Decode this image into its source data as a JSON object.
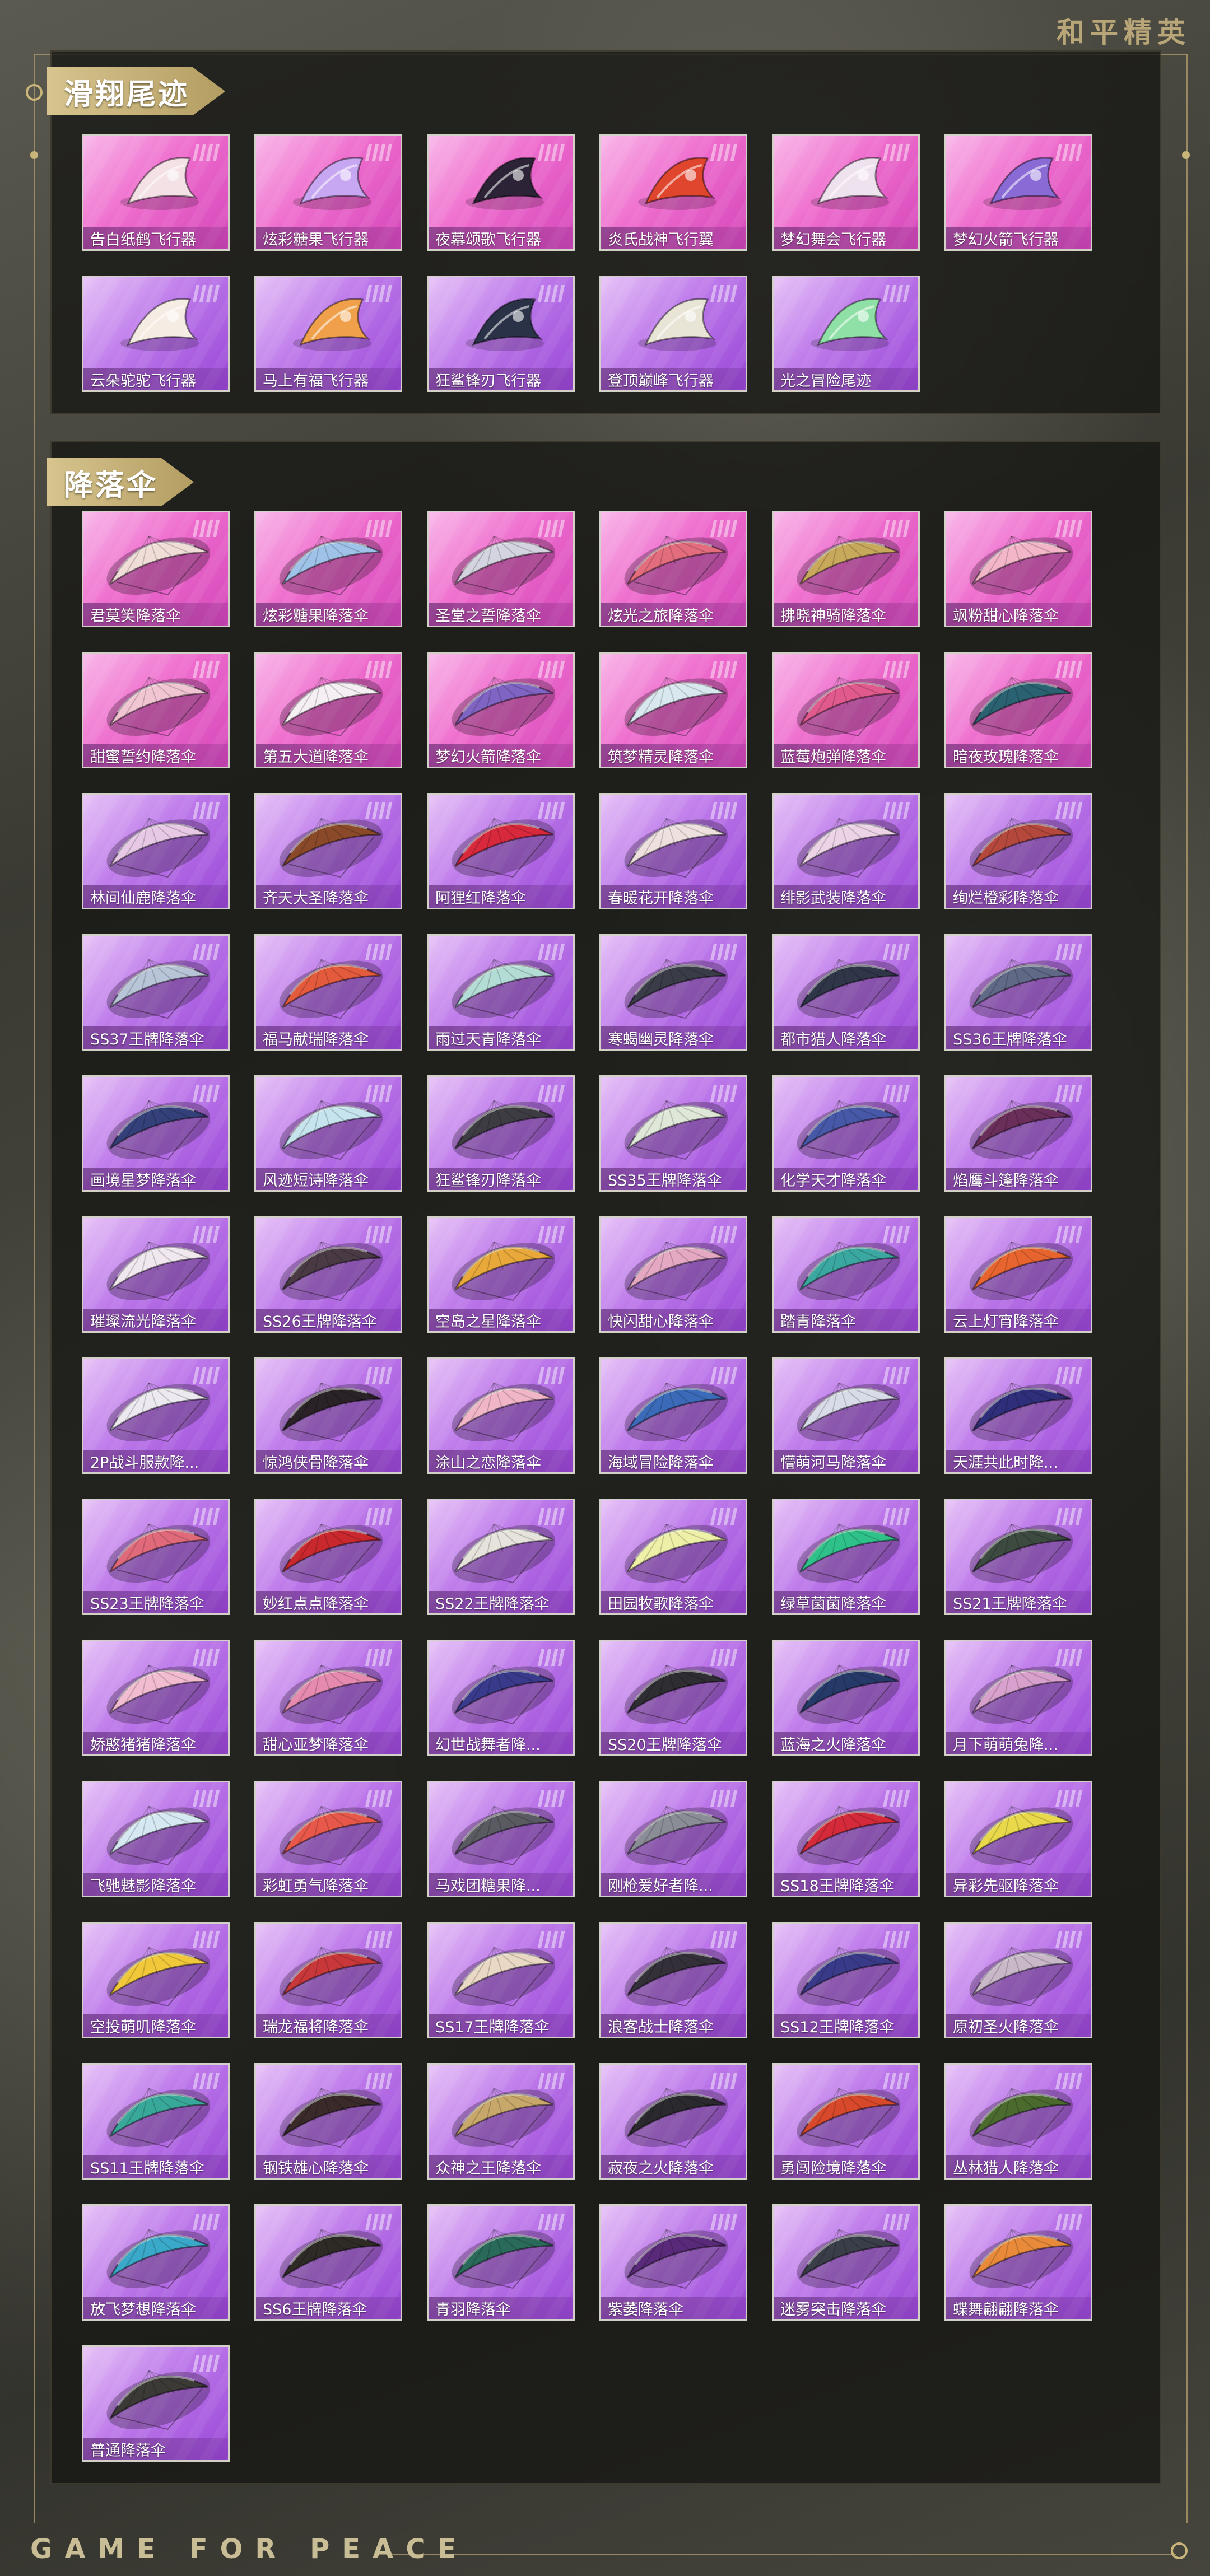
{
  "brand": {
    "top_title": "和平精英",
    "bottom_slogan": "GAME FOR PEACE"
  },
  "colors": {
    "rarity_pink": "#ee6ccd",
    "rarity_purple": "#bd79ea",
    "tag_gold": "#c9b57a"
  },
  "sections": [
    {
      "title": "滑翔尾迹",
      "items": [
        {
          "name": "告白纸鹤飞行器",
          "rarity": "pink",
          "icon": "paper-crane-glider-icon",
          "color": "#f3e1e6"
        },
        {
          "name": "炫彩糖果飞行器",
          "rarity": "pink",
          "icon": "candy-glider-icon",
          "color": "#c8a7f2"
        },
        {
          "name": "夜幕颂歌飞行器",
          "rarity": "pink",
          "icon": "spear-glider-icon",
          "color": "#2c2436"
        },
        {
          "name": "炎氏战神飞行翼",
          "rarity": "pink",
          "icon": "flame-wing-glider-icon",
          "color": "#e0462e"
        },
        {
          "name": "梦幻舞会飞行器",
          "rarity": "pink",
          "icon": "ghost-glider-icon",
          "color": "#efe2ef"
        },
        {
          "name": "梦幻火箭飞行器",
          "rarity": "pink",
          "icon": "rocket-glider-icon",
          "color": "#8a6bd6"
        },
        {
          "name": "云朵驼驼飞行器",
          "rarity": "purple",
          "icon": "alpaca-glider-icon",
          "color": "#f5ece3"
        },
        {
          "name": "马上有福飞行器",
          "rarity": "purple",
          "icon": "horse-glider-icon",
          "color": "#f0a04a"
        },
        {
          "name": "狂鲨锋刃飞行器",
          "rarity": "purple",
          "icon": "shark-glider-icon",
          "color": "#2a3247"
        },
        {
          "name": "登顶巅峰飞行器",
          "rarity": "purple",
          "icon": "peak-glider-icon",
          "color": "#e8e4d6"
        },
        {
          "name": "光之冒险尾迹",
          "rarity": "purple",
          "icon": "light-trail-icon",
          "color": "#8fe0a6"
        }
      ]
    },
    {
      "title": "降落伞",
      "items": [
        {
          "name": "君莫笑降落伞",
          "rarity": "pink",
          "icon": "parachute-icon",
          "color": "#f0ddd8"
        },
        {
          "name": "炫彩糖果降落伞",
          "rarity": "pink",
          "icon": "parachute-icon",
          "color": "#9fc2e8"
        },
        {
          "name": "圣堂之誓降落伞",
          "rarity": "pink",
          "icon": "parachute-icon",
          "color": "#d4d4e0"
        },
        {
          "name": "炫光之旅降落伞",
          "rarity": "pink",
          "icon": "parachute-icon",
          "color": "#e36d7c"
        },
        {
          "name": "拂晓神骑降落伞",
          "rarity": "pink",
          "icon": "parachute-icon",
          "color": "#c8a85a"
        },
        {
          "name": "飒粉甜心降落伞",
          "rarity": "pink",
          "icon": "parachute-icon",
          "color": "#f3b5c8"
        },
        {
          "name": "甜蜜誓约降落伞",
          "rarity": "pink",
          "icon": "parachute-icon",
          "color": "#f1c6d2"
        },
        {
          "name": "第五大道降落伞",
          "rarity": "pink",
          "icon": "parachute-icon",
          "color": "#f5eef2"
        },
        {
          "name": "梦幻火箭降落伞",
          "rarity": "pink",
          "icon": "parachute-icon",
          "color": "#8064c4"
        },
        {
          "name": "筑梦精灵降落伞",
          "rarity": "pink",
          "icon": "parachute-icon",
          "color": "#d8e8ee"
        },
        {
          "name": "蓝莓炮弹降落伞",
          "rarity": "pink",
          "icon": "parachute-icon",
          "color": "#e15a8e"
        },
        {
          "name": "暗夜玫瑰降落伞",
          "rarity": "pink",
          "icon": "parachute-icon",
          "color": "#2a6272"
        },
        {
          "name": "林间仙鹿降落伞",
          "rarity": "purple",
          "icon": "parachute-icon",
          "color": "#e7c9e6"
        },
        {
          "name": "齐天大圣降落伞",
          "rarity": "purple",
          "icon": "parachute-icon",
          "color": "#8a4a2a"
        },
        {
          "name": "阿狸红降落伞",
          "rarity": "purple",
          "icon": "parachute-icon",
          "color": "#d8283c"
        },
        {
          "name": "春暖花开降落伞",
          "rarity": "purple",
          "icon": "parachute-icon",
          "color": "#eee0de"
        },
        {
          "name": "绯影武装降落伞",
          "rarity": "purple",
          "icon": "parachute-icon",
          "color": "#ecd3e6"
        },
        {
          "name": "绚烂橙彩降落伞",
          "rarity": "purple",
          "icon": "parachute-icon",
          "color": "#b4483c"
        },
        {
          "name": "SS37王牌降落伞",
          "rarity": "purple",
          "icon": "parachute-icon",
          "color": "#b8c4d8"
        },
        {
          "name": "福马献瑞降落伞",
          "rarity": "purple",
          "icon": "parachute-icon",
          "color": "#e45a3c"
        },
        {
          "name": "雨过天青降落伞",
          "rarity": "purple",
          "icon": "parachute-icon",
          "color": "#b4dcd6"
        },
        {
          "name": "寒蝎幽灵降落伞",
          "rarity": "purple",
          "icon": "parachute-icon",
          "color": "#3a3c48"
        },
        {
          "name": "都市猎人降落伞",
          "rarity": "purple",
          "icon": "parachute-icon",
          "color": "#2e3648"
        },
        {
          "name": "SS36王牌降落伞",
          "rarity": "purple",
          "icon": "parachute-icon",
          "color": "#606a86"
        },
        {
          "name": "画境星梦降落伞",
          "rarity": "purple",
          "icon": "parachute-icon",
          "color": "#34407a"
        },
        {
          "name": "风迹短诗降落伞",
          "rarity": "purple",
          "icon": "parachute-icon",
          "color": "#c6e4ee"
        },
        {
          "name": "狂鲨锋刃降落伞",
          "rarity": "purple",
          "icon": "parachute-icon",
          "color": "#3c3c42"
        },
        {
          "name": "SS35王牌降落伞",
          "rarity": "purple",
          "icon": "parachute-icon",
          "color": "#dfe8d8"
        },
        {
          "name": "化学天才降落伞",
          "rarity": "purple",
          "icon": "parachute-icon",
          "color": "#4858a8"
        },
        {
          "name": "焰鹰斗篷降落伞",
          "rarity": "purple",
          "icon": "parachute-icon",
          "color": "#6a2e5a"
        },
        {
          "name": "璀璨流光降落伞",
          "rarity": "purple",
          "icon": "parachute-icon",
          "color": "#f0e8ee"
        },
        {
          "name": "SS26王牌降落伞",
          "rarity": "purple",
          "icon": "parachute-icon",
          "color": "#4a3a44"
        },
        {
          "name": "空岛之星降落伞",
          "rarity": "purple",
          "icon": "parachute-icon",
          "color": "#e8a93a"
        },
        {
          "name": "快闪甜心降落伞",
          "rarity": "purple",
          "icon": "parachute-icon",
          "color": "#e4a8c2"
        },
        {
          "name": "踏青降落伞",
          "rarity": "purple",
          "icon": "parachute-icon",
          "color": "#3aa8a0"
        },
        {
          "name": "云上灯宵降落伞",
          "rarity": "purple",
          "icon": "parachute-icon",
          "color": "#e8642e"
        },
        {
          "name": "2P战斗服款降...",
          "rarity": "purple",
          "icon": "parachute-icon",
          "color": "#eceaf0"
        },
        {
          "name": "惊鸿侠骨降落伞",
          "rarity": "purple",
          "icon": "parachute-icon",
          "color": "#2a2226"
        },
        {
          "name": "涂山之恋降落伞",
          "rarity": "purple",
          "icon": "parachute-icon",
          "color": "#f0b6c8"
        },
        {
          "name": "海域冒险降落伞",
          "rarity": "purple",
          "icon": "parachute-icon",
          "color": "#3a6ab8"
        },
        {
          "name": "懵萌河马降落伞",
          "rarity": "purple",
          "icon": "parachute-icon",
          "color": "#d8dce8"
        },
        {
          "name": "天涯共此时降...",
          "rarity": "purple",
          "icon": "parachute-icon",
          "color": "#2e2e7a"
        },
        {
          "name": "SS23王牌降落伞",
          "rarity": "purple",
          "icon": "parachute-icon",
          "color": "#e06a7a"
        },
        {
          "name": "妙红点点降落伞",
          "rarity": "purple",
          "icon": "parachute-icon",
          "color": "#c8282e"
        },
        {
          "name": "SS22王牌降落伞",
          "rarity": "purple",
          "icon": "parachute-icon",
          "color": "#e6e2dc"
        },
        {
          "name": "田园牧歌降落伞",
          "rarity": "purple",
          "icon": "parachute-icon",
          "color": "#eef0a8"
        },
        {
          "name": "绿草菌菌降落伞",
          "rarity": "purple",
          "icon": "parachute-icon",
          "color": "#2ec28a"
        },
        {
          "name": "SS21王牌降落伞",
          "rarity": "purple",
          "icon": "parachute-icon",
          "color": "#3c4a40"
        },
        {
          "name": "娇憨猪猪降落伞",
          "rarity": "purple",
          "icon": "parachute-icon",
          "color": "#f2bcd0"
        },
        {
          "name": "甜心亚梦降落伞",
          "rarity": "purple",
          "icon": "parachute-icon",
          "color": "#e68ab0"
        },
        {
          "name": "幻世战舞者降...",
          "rarity": "purple",
          "icon": "parachute-icon",
          "color": "#3a3a8c"
        },
        {
          "name": "SS20王牌降落伞",
          "rarity": "purple",
          "icon": "parachute-icon",
          "color": "#2e2e32"
        },
        {
          "name": "蓝海之火降落伞",
          "rarity": "purple",
          "icon": "parachute-icon",
          "color": "#263a6a"
        },
        {
          "name": "月下萌萌兔降...",
          "rarity": "purple",
          "icon": "parachute-icon",
          "color": "#d8a0cc"
        },
        {
          "name": "飞驰魅影降落伞",
          "rarity": "purple",
          "icon": "parachute-icon",
          "color": "#d6e8f2"
        },
        {
          "name": "彩虹勇气降落伞",
          "rarity": "purple",
          "icon": "parachute-icon",
          "color": "#e8584a"
        },
        {
          "name": "马戏团糖果降...",
          "rarity": "purple",
          "icon": "parachute-icon",
          "color": "#5a5a62"
        },
        {
          "name": "刚枪爱好者降...",
          "rarity": "purple",
          "icon": "parachute-icon",
          "color": "#8a8c96"
        },
        {
          "name": "SS18王牌降落伞",
          "rarity": "purple",
          "icon": "parachute-icon",
          "color": "#d42a3a"
        },
        {
          "name": "异彩先驱降落伞",
          "rarity": "purple",
          "icon": "parachute-icon",
          "color": "#e8d84a"
        },
        {
          "name": "空投萌叽降落伞",
          "rarity": "purple",
          "icon": "parachute-icon",
          "color": "#f0c83a"
        },
        {
          "name": "瑞龙福将降落伞",
          "rarity": "purple",
          "icon": "parachute-icon",
          "color": "#c8383a"
        },
        {
          "name": "SS17王牌降落伞",
          "rarity": "purple",
          "icon": "parachute-icon",
          "color": "#e8d8c4"
        },
        {
          "name": "浪客战士降落伞",
          "rarity": "purple",
          "icon": "parachute-icon",
          "color": "#34303a"
        },
        {
          "name": "SS12王牌降落伞",
          "rarity": "purple",
          "icon": "parachute-icon",
          "color": "#3a3a8a"
        },
        {
          "name": "原初圣火降落伞",
          "rarity": "purple",
          "icon": "parachute-icon",
          "color": "#c8b8c8"
        },
        {
          "name": "SS11王牌降落伞",
          "rarity": "purple",
          "icon": "parachute-icon",
          "color": "#38a89a"
        },
        {
          "name": "钢铁雄心降落伞",
          "rarity": "purple",
          "icon": "parachute-icon",
          "color": "#3a2a2a"
        },
        {
          "name": "众神之王降落伞",
          "rarity": "purple",
          "icon": "parachute-icon",
          "color": "#c8a86a"
        },
        {
          "name": "寂夜之火降落伞",
          "rarity": "purple",
          "icon": "parachute-icon",
          "color": "#2a2a2e"
        },
        {
          "name": "勇闯险境降落伞",
          "rarity": "purple",
          "icon": "parachute-icon",
          "color": "#d8482a"
        },
        {
          "name": "丛林猎人降落伞",
          "rarity": "purple",
          "icon": "parachute-icon",
          "color": "#4a6a2e"
        },
        {
          "name": "放飞梦想降落伞",
          "rarity": "purple",
          "icon": "parachute-icon",
          "color": "#3aa8c8"
        },
        {
          "name": "SS6王牌降落伞",
          "rarity": "purple",
          "icon": "parachute-icon",
          "color": "#2e2a26"
        },
        {
          "name": "青羽降落伞",
          "rarity": "purple",
          "icon": "parachute-icon",
          "color": "#2a6a5a"
        },
        {
          "name": "紫萎降落伞",
          "rarity": "purple",
          "icon": "parachute-icon",
          "color": "#5a2a7a"
        },
        {
          "name": "迷雾突击降落伞",
          "rarity": "purple",
          "icon": "parachute-icon",
          "color": "#3a3e48"
        },
        {
          "name": "蝶舞翩翩降落伞",
          "rarity": "purple",
          "icon": "parachute-icon",
          "color": "#e88a3a"
        },
        {
          "name": "普通降落伞",
          "rarity": "purple",
          "icon": "parachute-icon",
          "color": "#3c3a36"
        }
      ]
    }
  ]
}
